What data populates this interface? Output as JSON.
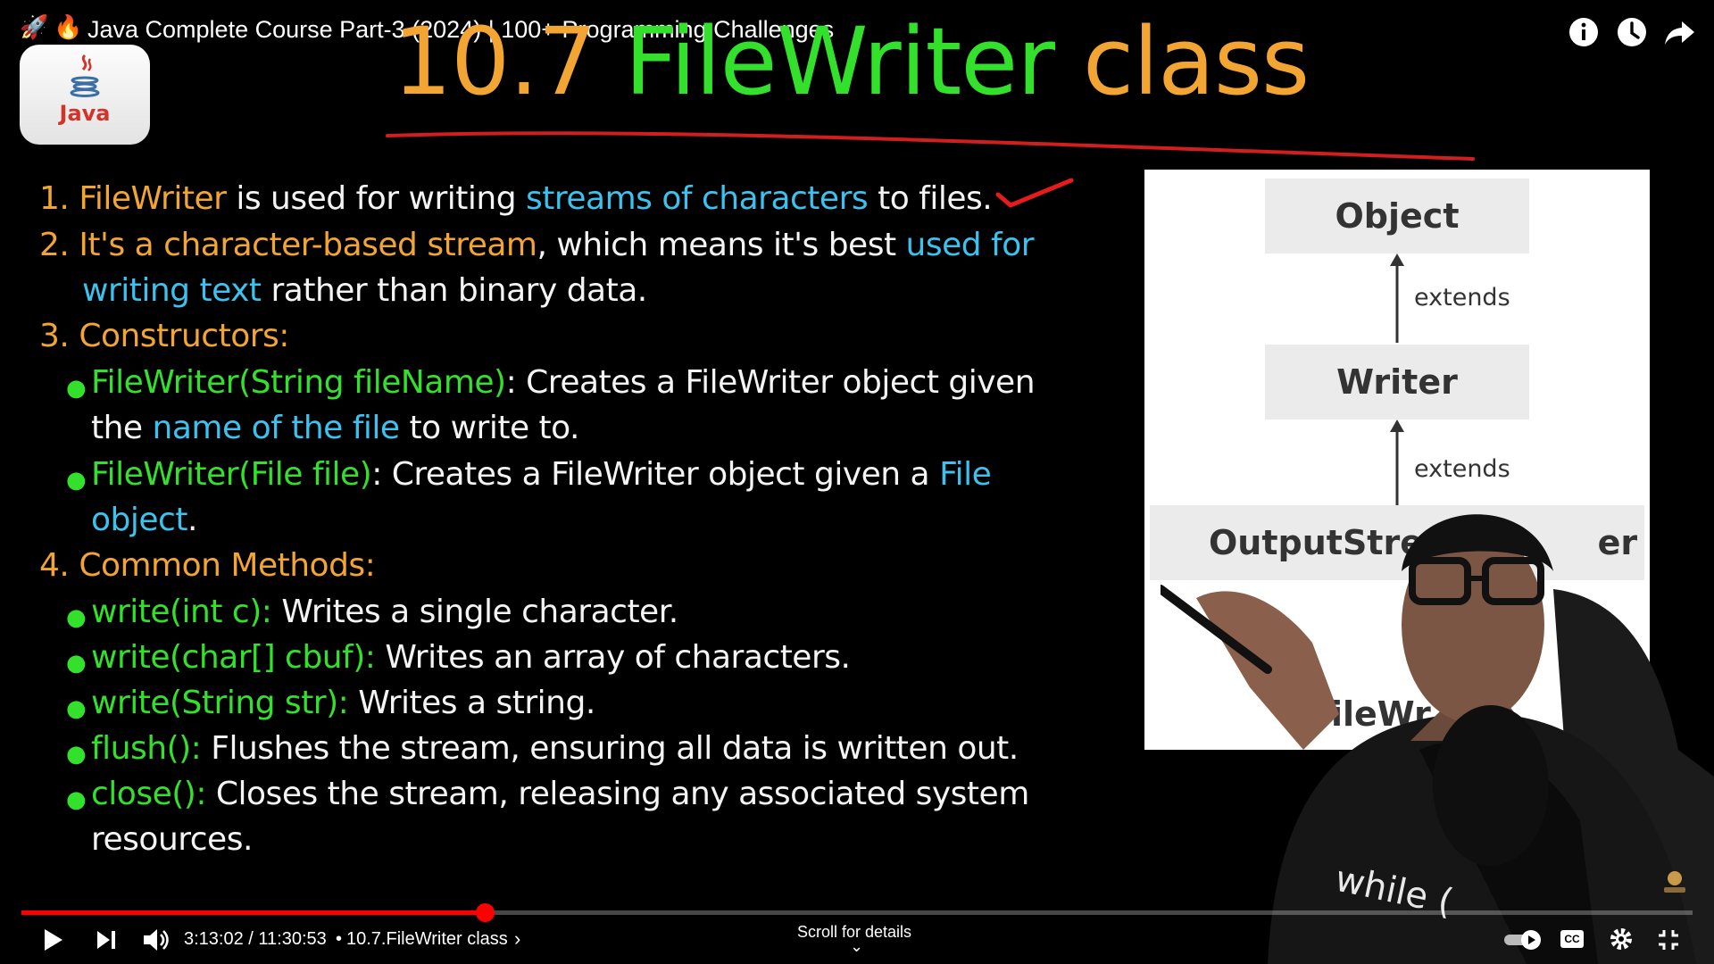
{
  "player": {
    "title": "Java Complete Course Part-3 (2024) | 100+ Programming Challenges",
    "title_emojis": [
      "🚀",
      "🔥"
    ],
    "channel_logo_text": "Java",
    "top_icons": [
      "info-icon",
      "watch-later-icon",
      "share-icon"
    ],
    "accent_color": "#ff0000",
    "progress_fraction": 0.277
  },
  "slide": {
    "title_number": "10.7",
    "title_main": "FileWriter",
    "title_tail": "class",
    "items": {
      "i1": {
        "num": "1.",
        "a": "FileWriter",
        "b": " is used for writing ",
        "c": "streams of characters",
        "d": " to files."
      },
      "i2": {
        "num": "2.",
        "a": "It's a character-based stream",
        "b": ", which means it's best ",
        "c": "used for",
        "d": "writing text",
        "e": " rather than binary data."
      },
      "i3": {
        "num": "3.",
        "a": "Constructors:"
      },
      "c1": {
        "a": "FileWriter(String fileName)",
        "b": ": Creates a FileWriter object given",
        "c": "the ",
        "d": "name of the file",
        "e": " to write to."
      },
      "c2": {
        "a": "FileWriter(File file)",
        "b": ": Creates a FileWriter object given a ",
        "c": "File",
        "d": "object",
        "e": "."
      },
      "i4": {
        "num": "4.",
        "a": "Common Methods:"
      },
      "m1": {
        "a": "write(int c):",
        "b": " Writes a single character."
      },
      "m2": {
        "a": "write(char[] cbuf):",
        "b": " Writes an array of characters."
      },
      "m3": {
        "a": "write(String str):",
        "b": " Writes a string."
      },
      "m4": {
        "a": "flush():",
        "b": " Flushes the stream, ensuring all data is written out."
      },
      "m5": {
        "a": "close():",
        "b": " Closes the stream, releasing any associated system",
        "c": "resources."
      }
    }
  },
  "diagram": {
    "nodes": [
      "Object",
      "Writer",
      "OutputStrea",
      "er",
      "FileWr"
    ],
    "edge_label": "extends"
  },
  "presenter": {
    "shirt_text": "while ("
  },
  "controls": {
    "time": "3:13:02 / 11:30:53",
    "separator": "•",
    "chapter": "10.7.FileWriter class",
    "chapter_chevron": "›",
    "scroll_hint": "Scroll for details",
    "scroll_chevron": "⌄",
    "cc_label": "CC"
  }
}
